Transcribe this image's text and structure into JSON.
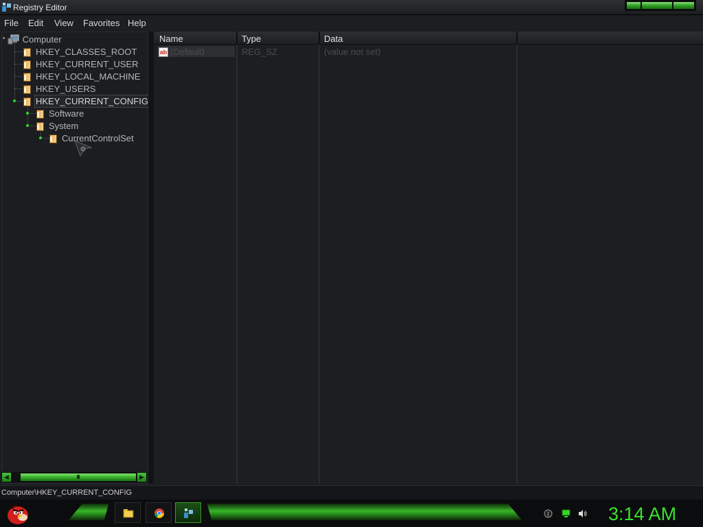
{
  "window": {
    "title": "Registry Editor",
    "icon": "registry-editor-icon"
  },
  "menu": {
    "items": [
      {
        "label": "File"
      },
      {
        "label": "Edit"
      },
      {
        "label": "View"
      },
      {
        "label": "Favorites"
      },
      {
        "label": "Help"
      }
    ]
  },
  "tree": {
    "root": {
      "label": "Computer",
      "icon": "computer-icon"
    },
    "hives": [
      {
        "label": "HKEY_CLASSES_ROOT"
      },
      {
        "label": "HKEY_CURRENT_USER"
      },
      {
        "label": "HKEY_LOCAL_MACHINE"
      },
      {
        "label": "HKEY_USERS"
      },
      {
        "label": "HKEY_CURRENT_CONFIG",
        "selected": true
      }
    ],
    "children": [
      {
        "label": "Software"
      },
      {
        "label": "System"
      }
    ],
    "grandchildren": [
      {
        "label": "CurrentControlSet"
      }
    ]
  },
  "list": {
    "columns": [
      {
        "label": "Name"
      },
      {
        "label": "Type"
      },
      {
        "label": "Data"
      }
    ],
    "rows": [
      {
        "name": "(Default)",
        "type": "REG_SZ",
        "data": "(value not set)",
        "icon": "string-value-icon"
      }
    ]
  },
  "statusbar": {
    "path": "Computer\\HKEY_CURRENT_CONFIG"
  },
  "taskbar": {
    "clock": "3:14 AM",
    "pinned": [
      "file-explorer-icon",
      "chrome-icon",
      "registry-editor-icon"
    ],
    "tray": [
      "keyboard-icon",
      "network-icon",
      "volume-icon"
    ]
  },
  "colors": {
    "accent": "#39e12b",
    "background": "#1b1d20"
  }
}
